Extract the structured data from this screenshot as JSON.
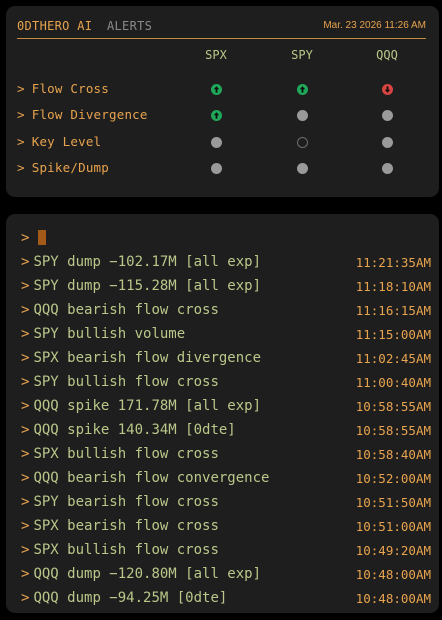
{
  "header": {
    "brand": "0DTHERO AI",
    "tab": "ALERTS",
    "datetime": "Mar. 23 2026 11:26 AM"
  },
  "columns": [
    "SPX",
    "SPY",
    "QQQ"
  ],
  "signals": [
    {
      "label": "Flow Cross",
      "states": [
        "up",
        "up",
        "down"
      ]
    },
    {
      "label": "Flow Divergence",
      "states": [
        "up",
        "neutral",
        "neutral"
      ]
    },
    {
      "label": "Key Level",
      "states": [
        "neutral",
        "empty",
        "neutral"
      ]
    },
    {
      "label": "Spike/Dump",
      "states": [
        "neutral",
        "neutral",
        "neutral"
      ]
    }
  ],
  "prompt": ">",
  "caret": ">",
  "alerts": [
    {
      "message": "SPY dump −102.17M [all exp]",
      "time": "11:21:35AM"
    },
    {
      "message": "SPY dump −115.28M [all exp]",
      "time": "11:18:10AM"
    },
    {
      "message": "QQQ bearish flow cross",
      "time": "11:16:15AM"
    },
    {
      "message": "SPY bullish volume",
      "time": "11:15:00AM"
    },
    {
      "message": "SPX bearish flow divergence",
      "time": "11:02:45AM"
    },
    {
      "message": "SPY bullish flow cross",
      "time": "11:00:40AM"
    },
    {
      "message": "QQQ spike 171.78M [all exp]",
      "time": "10:58:55AM"
    },
    {
      "message": "QQQ spike 140.34M [0dte]",
      "time": "10:58:55AM"
    },
    {
      "message": "SPX bullish flow cross",
      "time": "10:58:40AM"
    },
    {
      "message": "QQQ bearish flow convergence",
      "time": "10:52:00AM"
    },
    {
      "message": "SPY bearish flow cross",
      "time": "10:51:50AM"
    },
    {
      "message": "SPX bearish flow cross",
      "time": "10:51:00AM"
    },
    {
      "message": "SPX bullish flow cross",
      "time": "10:49:20AM"
    },
    {
      "message": "QQQ dump −120.80M [all exp]",
      "time": "10:48:00AM"
    },
    {
      "message": "QQQ dump −94.25M [0dte]",
      "time": "10:48:00AM"
    }
  ]
}
